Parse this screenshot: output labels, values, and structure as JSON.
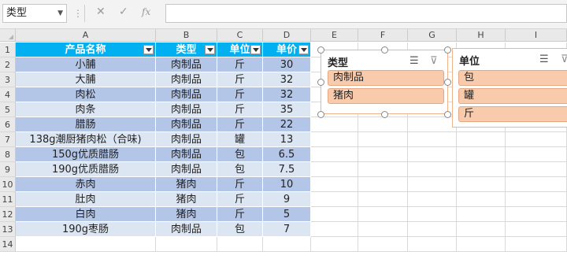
{
  "formula_bar": {
    "name_box": "类型",
    "dots": "⋮",
    "cancel_icon": "✕",
    "enter_icon": "✓",
    "fx_label": "fx",
    "formula": ""
  },
  "columns": [
    "A",
    "B",
    "C",
    "D",
    "E",
    "F",
    "G",
    "H",
    "I"
  ],
  "rows": [
    "1",
    "2",
    "3",
    "4",
    "5",
    "6",
    "7",
    "8",
    "9",
    "10",
    "11",
    "12",
    "13",
    "14"
  ],
  "table": {
    "headers": [
      "产品名称",
      "类型",
      "单位",
      "单价"
    ],
    "rows": [
      [
        "小脯",
        "肉制品",
        "斤",
        "30"
      ],
      [
        "大脯",
        "肉制品",
        "斤",
        "32"
      ],
      [
        "肉松",
        "肉制品",
        "斤",
        "32"
      ],
      [
        "肉条",
        "肉制品",
        "斤",
        "35"
      ],
      [
        "腊肠",
        "肉制品",
        "斤",
        "22"
      ],
      [
        "138g潮厨猪肉松（合味)",
        "肉制品",
        "罐",
        "13"
      ],
      [
        "150g优质腊肠",
        "肉制品",
        "包",
        "6.5"
      ],
      [
        "190g优质腊肠",
        "肉制品",
        "包",
        "7.5"
      ],
      [
        "赤肉",
        "猪肉",
        "斤",
        "10"
      ],
      [
        "肚肉",
        "猪肉",
        "斤",
        "9"
      ],
      [
        "白肉",
        "猪肉",
        "斤",
        "5"
      ],
      [
        "190g枣肠",
        "肉制品",
        "包",
        "7"
      ]
    ]
  },
  "slicer_type": {
    "title": "类型",
    "items": [
      "肉制品",
      "猪肉"
    ]
  },
  "slicer_unit": {
    "title": "单位",
    "items": [
      "包",
      "罐",
      "斤"
    ]
  },
  "colors": {
    "header": "#00b0f0",
    "band_dark": "#b4c6e7",
    "band_light": "#dce6f2",
    "slicer_item": "#f9cbad"
  }
}
